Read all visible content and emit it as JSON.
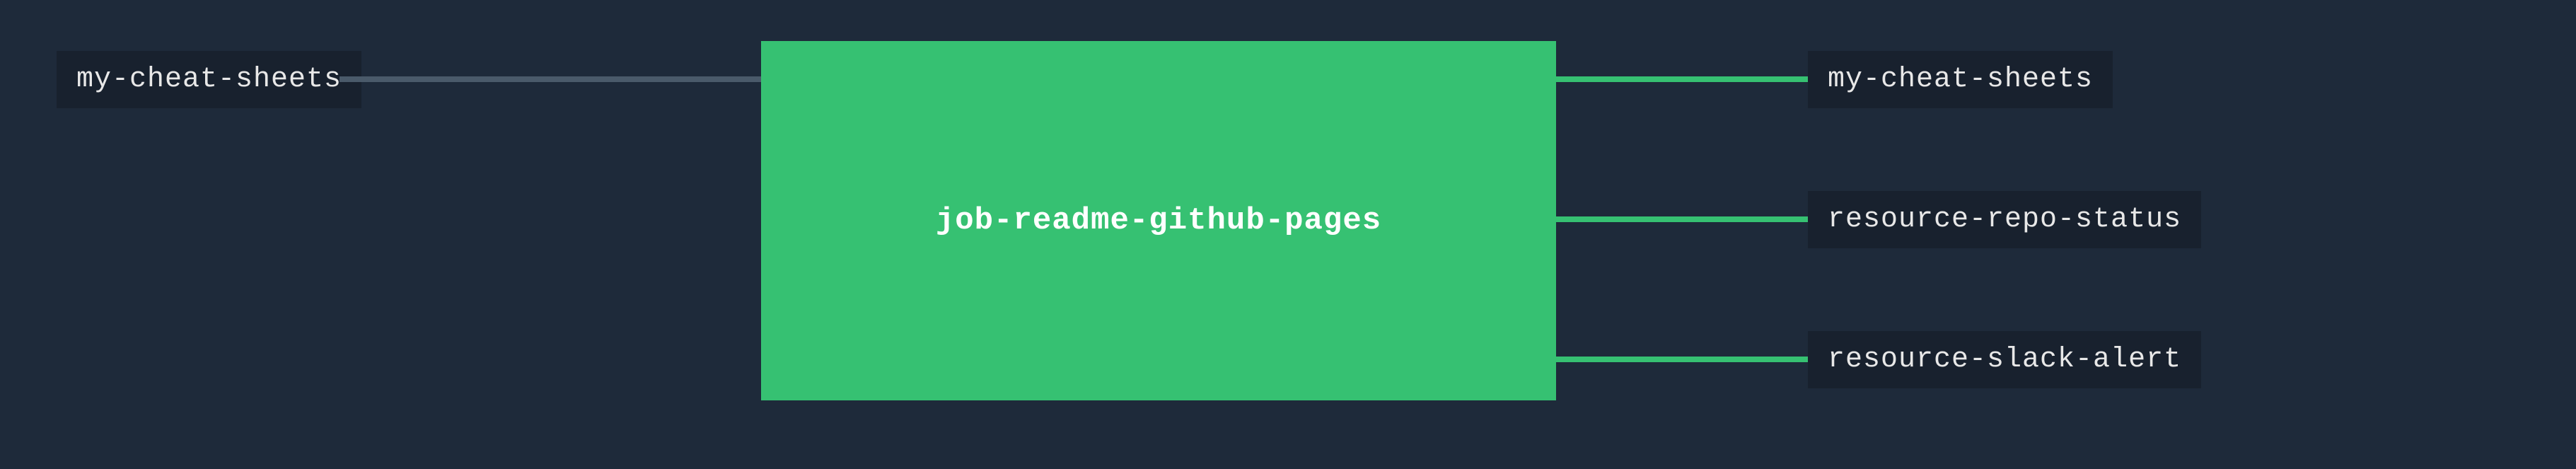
{
  "pipeline": {
    "input": {
      "label": "my-cheat-sheets"
    },
    "job": {
      "label": "job-readme-github-pages"
    },
    "outputs": [
      {
        "label": "my-cheat-sheets"
      },
      {
        "label": "resource-repo-status"
      },
      {
        "label": "resource-slack-alert"
      }
    ],
    "colors": {
      "background": "#1e2a3a",
      "node_dark": "#18212e",
      "job_green": "#36c172",
      "connector_gray": "#4a5a6a",
      "connector_green": "#36c172",
      "text_light": "#e8e8e8",
      "text_white": "#ffffff"
    }
  }
}
